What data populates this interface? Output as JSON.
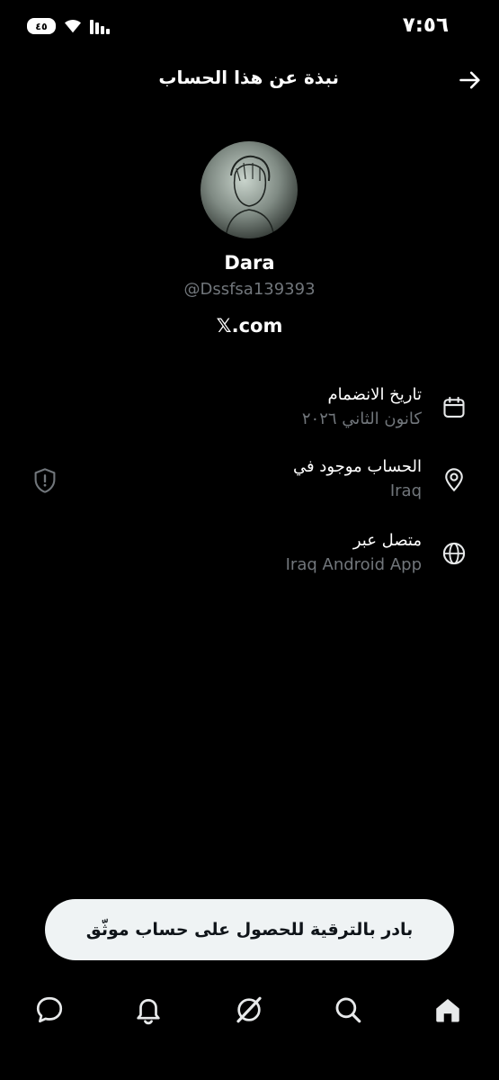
{
  "status_bar": {
    "time": "٧:٥٦",
    "battery": "٤٥",
    "icons": [
      "battery-icon",
      "wifi-icon",
      "signal-icon"
    ]
  },
  "header": {
    "title": "نبذة عن هذا الحساب",
    "back_icon": "arrow-right-icon"
  },
  "profile": {
    "name": "Dara",
    "handle": "@Dssfsa139393",
    "link": "𝕏.com"
  },
  "info": [
    {
      "icon": "calendar-icon",
      "title": "تاريخ الانضمام",
      "value": "كانون الثاني ٢٠٢٦"
    },
    {
      "icon": "location-pin-icon",
      "title": "الحساب موجود في",
      "value": "Iraq"
    },
    {
      "icon": "globe-icon",
      "title": "متصل عبر",
      "value": "Iraq Android App"
    }
  ],
  "upgrade": {
    "label": "بادر بالترقية للحصول على حساب موثّق"
  },
  "bottom_nav": [
    "home-icon",
    "search-icon",
    "grok-icon",
    "notifications-icon",
    "messages-icon"
  ],
  "colors": {
    "background": "#000000",
    "primary_text": "#e7e9ea",
    "secondary_text": "#71767b",
    "banner": "#eff3f4"
  }
}
